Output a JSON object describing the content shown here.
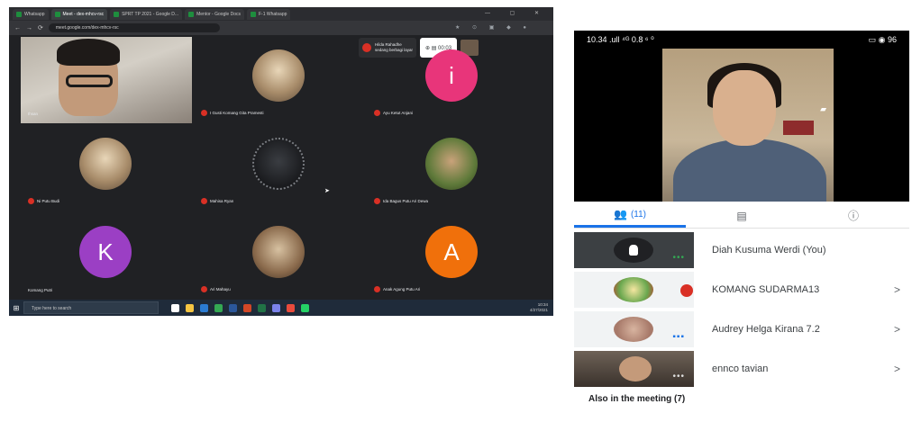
{
  "desktop": {
    "browser": {
      "tabs": [
        {
          "label": "Whatsapp"
        },
        {
          "label": "Meet - dex-mhcv-rsc"
        },
        {
          "label": "SPRT TP 2021 - Google D..."
        },
        {
          "label": "Mentor - Google Docs"
        },
        {
          "label": "F-1 Whatsapp"
        }
      ],
      "window_controls": "— ▢ ✕",
      "url": "meet.google.com/dex-mhcv-rsc",
      "ext_icons": "★ ⊙ ▣ ◆ ●"
    },
    "meet_top": {
      "presenter_name": "Hilda Rahadhe",
      "presenter_sub": "sedang berbagi layar",
      "tools_text": "⊕  ▤  00:03",
      "people_icon": "people-icon"
    },
    "tiles": [
      {
        "name": "Ihsan",
        "avatar_letter": ""
      },
      {
        "name": "I Gusti Komang Gita Pramesti",
        "avatar_letter": ""
      },
      {
        "name": "Ayu Ketut Anjani",
        "avatar_letter": "i"
      },
      {
        "name": "Ni Putu Budi",
        "avatar_letter": ""
      },
      {
        "name": "Mahisa Ryan",
        "avatar_letter": ""
      },
      {
        "name": "Ida Bagus Putu Ari Dewa",
        "avatar_letter": ""
      },
      {
        "name": "Komang Putri",
        "avatar_letter": "K"
      },
      {
        "name": "Ari Mahayu",
        "avatar_letter": ""
      },
      {
        "name": "Anak Agung Putu Ari",
        "avatar_letter": "A"
      }
    ],
    "taskbar": {
      "search_placeholder": "Type here to search",
      "tray_time": "10:34",
      "tray_date": "4/27/2021"
    }
  },
  "phone": {
    "status": {
      "left": "10.34 .ull ⁴ᴳ 0.8 ⁶ ⁰",
      "right": "▭ ◉ 96"
    },
    "tabs": [
      {
        "label": "(11)",
        "icon": "people-icon"
      },
      {
        "label": "",
        "icon": "chat-icon"
      },
      {
        "label": "",
        "icon": "info-icon"
      }
    ],
    "participants": [
      {
        "name": "Diah Kusuma Werdi (You)",
        "chevron": ""
      },
      {
        "name": "KOMANG SUDARMA13",
        "chevron": ">"
      },
      {
        "name": "Audrey Helga Kirana 7.2",
        "chevron": ">"
      },
      {
        "name": "ennco tavian",
        "chevron": ">"
      }
    ],
    "also_in_meeting": "Also in the meeting (7)"
  }
}
